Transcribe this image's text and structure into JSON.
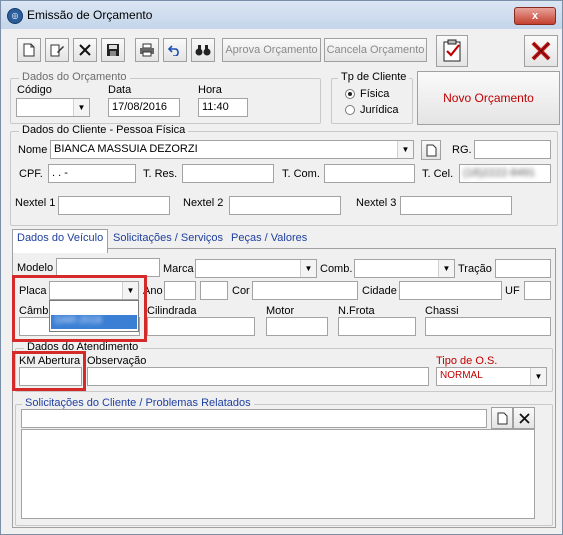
{
  "window": {
    "title": "Emissão de Orçamento",
    "close_label": "x"
  },
  "toolbar": {
    "approve_label": "Aprova Orçamento",
    "cancel_label": "Cancela Orçamento"
  },
  "budget": {
    "group_title": "Dados do Orçamento",
    "code_label": "Código",
    "code_value": "",
    "date_label": "Data",
    "date_value": "17/08/2016",
    "time_label": "Hora",
    "time_value": "11:40"
  },
  "client_type": {
    "group_title": "Tp de Cliente",
    "option_fisica": "Física",
    "option_juridica": "Jurídica",
    "selected": "Física"
  },
  "new_budget_label": "Novo Orçamento",
  "client": {
    "group_title": "Dados do Cliente  - Pessoa Física",
    "name_label": "Nome",
    "name_value": "BIANCA MASSUIA DEZORZI",
    "rg_label": "RG.",
    "rg_value": "",
    "cpf_label": "CPF.",
    "cpf_value": ".    .     -",
    "tres_label": "T. Res.",
    "tres_value": "",
    "tcom_label": "T. Com.",
    "tcom_value": "",
    "tcel_label": "T. Cel.",
    "tcel_value": "(18)2222-8491",
    "nextel1_label": "Nextel 1",
    "nextel2_label": "Nextel 2",
    "nextel3_label": "Nextel 3"
  },
  "tabs": [
    {
      "label": "Dados do Veículo"
    },
    {
      "label": "Solicitações / Serviços"
    },
    {
      "label": "Peças / Valores"
    }
  ],
  "vehicle": {
    "modelo_label": "Modelo",
    "marca_label": "Marca",
    "comb_label": "Comb.",
    "tracao_label": "Tração",
    "placa_label": "Placa",
    "placa_option": "DAR-2018",
    "ano_label": "Ano",
    "cor_label": "Cor",
    "cidade_label": "Cidade",
    "uf_label": "UF",
    "cambio_label": "Câmbio",
    "cilindrada_label": "Cilindrada",
    "motor_label": "Motor",
    "nfrota_label": "N.Frota",
    "chassi_label": "Chassi"
  },
  "service": {
    "group_title": "Dados do Atendimento",
    "km_label": "KM Abertura",
    "obs_label": "Observação",
    "os_type_label": "Tipo de O.S.",
    "os_type_value": "NORMAL"
  },
  "requests": {
    "group_title": "Solicitações do Cliente / Problemas Relatados"
  },
  "colors": {
    "accent_red": "#d42a2a",
    "tab_blue": "#1f3fa0",
    "new_budget_red": "#c00000"
  }
}
